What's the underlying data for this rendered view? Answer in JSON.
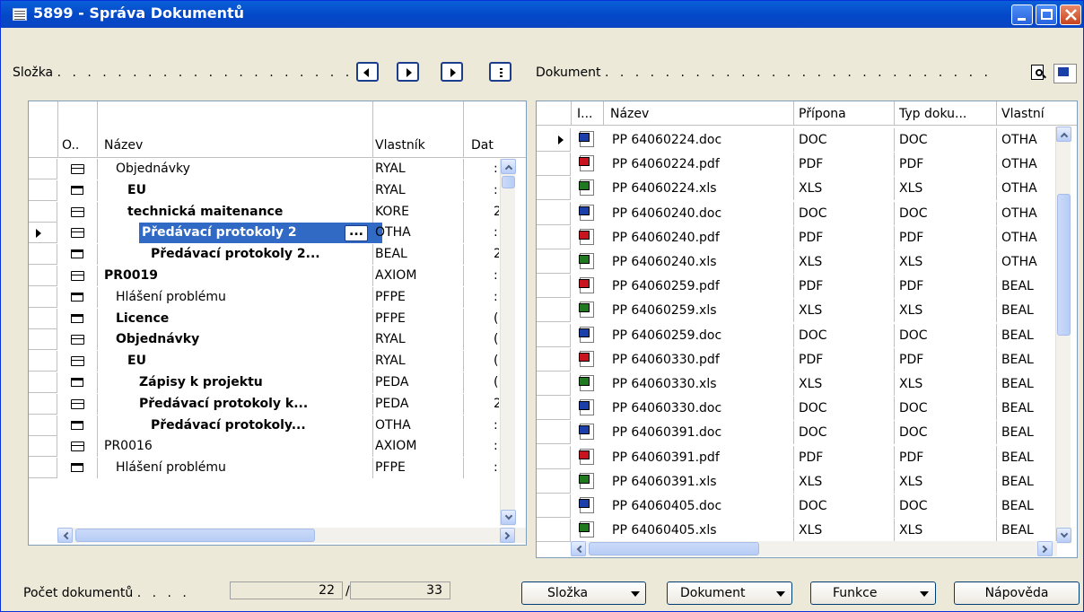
{
  "window": {
    "title": "5899 - Správa Dokumentů"
  },
  "left_panel": {
    "label": "Složka",
    "columns": [
      "O..",
      "Název",
      "Vlastník",
      "Dat"
    ],
    "rows": [
      {
        "icon": "folder-open",
        "name": "Objednávky",
        "owner": "RYAL",
        "indent": 1,
        "bold": false,
        "date": ":"
      },
      {
        "icon": "folder-closed",
        "name": "EU",
        "owner": "RYAL",
        "indent": 2,
        "bold": true,
        "date": ":"
      },
      {
        "icon": "folder-open",
        "name": "technická maitenance",
        "owner": "KORE",
        "indent": 2,
        "bold": true,
        "date": "2"
      },
      {
        "icon": "folder-open",
        "name": "Předávací protokoly 2",
        "owner": "OTHA",
        "indent": 3,
        "bold": true,
        "date": ":",
        "selected": true
      },
      {
        "icon": "folder-closed",
        "name": "Předávací protokoly 2...",
        "owner": "BEAL",
        "indent": 4,
        "bold": true,
        "date": "2"
      },
      {
        "icon": "folder-open",
        "name": "PR0019",
        "owner": "AXIOM",
        "indent": 0,
        "bold": true,
        "date": ":"
      },
      {
        "icon": "folder-closed",
        "name": "Hlášení problému",
        "owner": "PFPE",
        "indent": 1,
        "bold": false,
        "date": ":"
      },
      {
        "icon": "folder-closed",
        "name": "Licence",
        "owner": "PFPE",
        "indent": 1,
        "bold": true,
        "date": "("
      },
      {
        "icon": "folder-open",
        "name": "Objednávky",
        "owner": "RYAL",
        "indent": 1,
        "bold": true,
        "date": "("
      },
      {
        "icon": "folder-open",
        "name": "EU",
        "owner": "RYAL",
        "indent": 2,
        "bold": true,
        "date": "("
      },
      {
        "icon": "folder-closed",
        "name": "Zápisy k projektu",
        "owner": "PEDA",
        "indent": 3,
        "bold": true,
        "date": "("
      },
      {
        "icon": "folder-open",
        "name": "Předávací protokoly k...",
        "owner": "PEDA",
        "indent": 3,
        "bold": true,
        "date": "2"
      },
      {
        "icon": "folder-closed",
        "name": "Předávací protokoly...",
        "owner": "OTHA",
        "indent": 4,
        "bold": true,
        "date": ":"
      },
      {
        "icon": "folder-open",
        "name": "PR0016",
        "owner": "AXIOM",
        "indent": 0,
        "bold": false,
        "date": ":"
      },
      {
        "icon": "folder-closed",
        "name": "Hlášení problému",
        "owner": "PFPE",
        "indent": 1,
        "bold": false,
        "date": ":"
      }
    ]
  },
  "right_panel": {
    "label": "Dokument",
    "columns": [
      "I...",
      "Název",
      "Přípona",
      "Typ doku...",
      "Vlastní"
    ],
    "rows": [
      {
        "type": "doc",
        "name": "PP 64060224.doc",
        "ext": "DOC",
        "doctype": "DOC",
        "owner": "OTHA"
      },
      {
        "type": "pdf",
        "name": "PP 64060224.pdf",
        "ext": "PDF",
        "doctype": "PDF",
        "owner": "OTHA"
      },
      {
        "type": "xls",
        "name": "PP 64060224.xls",
        "ext": "XLS",
        "doctype": "XLS",
        "owner": "OTHA"
      },
      {
        "type": "doc",
        "name": "PP 64060240.doc",
        "ext": "DOC",
        "doctype": "DOC",
        "owner": "OTHA"
      },
      {
        "type": "pdf",
        "name": "PP 64060240.pdf",
        "ext": "PDF",
        "doctype": "PDF",
        "owner": "OTHA"
      },
      {
        "type": "xls",
        "name": "PP 64060240.xls",
        "ext": "XLS",
        "doctype": "XLS",
        "owner": "OTHA"
      },
      {
        "type": "pdf",
        "name": "PP 64060259.pdf",
        "ext": "PDF",
        "doctype": "PDF",
        "owner": "BEAL"
      },
      {
        "type": "xls",
        "name": "PP 64060259.xls",
        "ext": "XLS",
        "doctype": "XLS",
        "owner": "BEAL"
      },
      {
        "type": "doc",
        "name": "PP 64060259.doc",
        "ext": "DOC",
        "doctype": "DOC",
        "owner": "BEAL"
      },
      {
        "type": "pdf",
        "name": "PP 64060330.pdf",
        "ext": "PDF",
        "doctype": "PDF",
        "owner": "BEAL"
      },
      {
        "type": "xls",
        "name": "PP 64060330.xls",
        "ext": "XLS",
        "doctype": "XLS",
        "owner": "BEAL"
      },
      {
        "type": "doc",
        "name": "PP 64060330.doc",
        "ext": "DOC",
        "doctype": "DOC",
        "owner": "BEAL"
      },
      {
        "type": "doc",
        "name": "PP 64060391.doc",
        "ext": "DOC",
        "doctype": "DOC",
        "owner": "BEAL"
      },
      {
        "type": "pdf",
        "name": "PP 64060391.pdf",
        "ext": "PDF",
        "doctype": "PDF",
        "owner": "BEAL"
      },
      {
        "type": "xls",
        "name": "PP 64060391.xls",
        "ext": "XLS",
        "doctype": "XLS",
        "owner": "BEAL"
      },
      {
        "type": "doc",
        "name": "PP 64060405.doc",
        "ext": "DOC",
        "doctype": "DOC",
        "owner": "BEAL"
      },
      {
        "type": "xls",
        "name": "PP 64060405.xls",
        "ext": "XLS",
        "doctype": "XLS",
        "owner": "BEAL"
      }
    ]
  },
  "footer": {
    "count_label": "Počet dokumentů",
    "count_current": "22",
    "separator": "/",
    "count_total": "33",
    "buttons": {
      "folder": "Složka",
      "document": "Dokument",
      "functions": "Funkce",
      "help": "Nápověda"
    }
  },
  "colors": {
    "title_bar": "#0348c8",
    "selection": "#316ac5",
    "window_bg": "#ece9d8"
  },
  "icons": {
    "left_nav": [
      "prev-icon",
      "next-icon",
      "next-icon",
      "list-icon"
    ],
    "right_toolbar": [
      "preview-icon",
      "word-doc-icon"
    ]
  }
}
